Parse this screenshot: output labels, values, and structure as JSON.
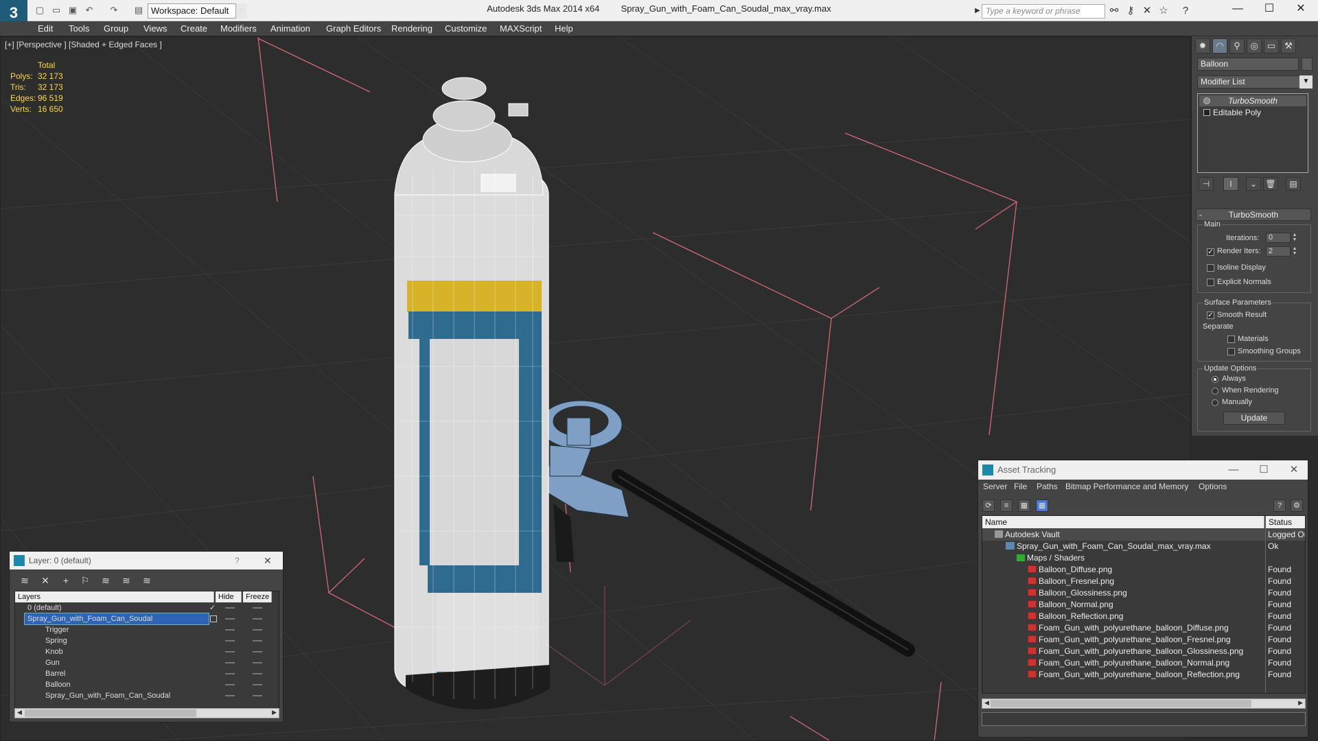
{
  "title_bar": {
    "app_title": "Autodesk 3ds Max  2014 x64",
    "file_name": "Spray_Gun_with_Foam_Can_Soudal_max_vray.max",
    "workspace": "Workspace: Default",
    "search_placeholder": "Type a keyword or phrase",
    "logo": "3"
  },
  "menu": [
    "Edit",
    "Tools",
    "Group",
    "Views",
    "Create",
    "Modifiers",
    "Animation",
    "Graph Editors",
    "Rendering",
    "Customize",
    "MAXScript",
    "Help"
  ],
  "viewport": {
    "label": "[+] [Perspective ] [Shaded + Edged Faces ]",
    "stats_header": "Total",
    "stats": [
      {
        "label": "Polys:",
        "value": "32 173"
      },
      {
        "label": "Tris:",
        "value": "32 173"
      },
      {
        "label": "Edges:",
        "value": "96 519"
      },
      {
        "label": "Verts:",
        "value": "16 650"
      }
    ]
  },
  "command_panel": {
    "object_name": "Balloon",
    "modifier_list": "Modifier List",
    "stack": [
      "TurboSmooth",
      "Editable Poly"
    ],
    "rollout_title": "TurboSmooth",
    "main_group": "Main",
    "iterations_label": "Iterations:",
    "iterations_value": "0",
    "render_iters_label": "Render Iters:",
    "render_iters_value": "2",
    "render_iters_checked": true,
    "isoline_label": "Isoline Display",
    "explicit_normals_label": "Explicit Normals",
    "surface_group": "Surface Parameters",
    "smooth_result_label": "Smooth Result",
    "separate_label": "Separate",
    "materials_label": "Materials",
    "smoothing_groups_label": "Smoothing Groups",
    "update_group": "Update Options",
    "update_options": [
      "Always",
      "When Rendering",
      "Manually"
    ],
    "update_selected": "Always",
    "update_button": "Update"
  },
  "layer_dialog": {
    "title": "Layer: 0 (default)",
    "help": "?",
    "close": "✕",
    "columns": {
      "layers": "Layers",
      "hide": "Hide",
      "freeze": "Freeze"
    },
    "rows": [
      "0 (default)",
      "Spray_Gun_with_Foam_Can_Soudal",
      "Trigger",
      "Spring",
      "Knob",
      "Gun",
      "Barrel",
      "Balloon",
      "Spray_Gun_with_Foam_Can_Soudal"
    ]
  },
  "asset_tracking": {
    "title": "Asset Tracking",
    "menu": [
      "Server",
      "File",
      "Paths",
      "Bitmap Performance and Memory",
      "Options"
    ],
    "columns": {
      "name": "Name",
      "status": "Status"
    },
    "rows": [
      {
        "name": "Autodesk Vault",
        "status": "Logged Ou"
      },
      {
        "name": "Spray_Gun_with_Foam_Can_Soudal_max_vray.max",
        "status": "Ok"
      },
      {
        "name": "Maps / Shaders",
        "status": ""
      },
      {
        "name": "Balloon_Diffuse.png",
        "status": "Found"
      },
      {
        "name": "Balloon_Fresnel.png",
        "status": "Found"
      },
      {
        "name": "Balloon_Glossiness.png",
        "status": "Found"
      },
      {
        "name": "Balloon_Normal.png",
        "status": "Found"
      },
      {
        "name": "Balloon_Reflection.png",
        "status": "Found"
      },
      {
        "name": "Foam_Gun_with_polyurethane_balloon_Diffuse.png",
        "status": "Found"
      },
      {
        "name": "Foam_Gun_with_polyurethane_balloon_Fresnel.png",
        "status": "Found"
      },
      {
        "name": "Foam_Gun_with_polyurethane_balloon_Glossiness.png",
        "status": "Found"
      },
      {
        "name": "Foam_Gun_with_polyurethane_balloon_Normal.png",
        "status": "Found"
      },
      {
        "name": "Foam_Gun_with_polyurethane_balloon_Reflection.png",
        "status": "Found"
      }
    ]
  },
  "colors": {
    "viewport_bg": "#2d2d2d",
    "grid": "#3a3a3a",
    "stats_yellow": "#ffd84a",
    "bounding_box": "#d4677a",
    "can_blue": "#2f6a8f",
    "can_yellow": "#d8b32a",
    "gun_blue": "#7fa0c4"
  }
}
